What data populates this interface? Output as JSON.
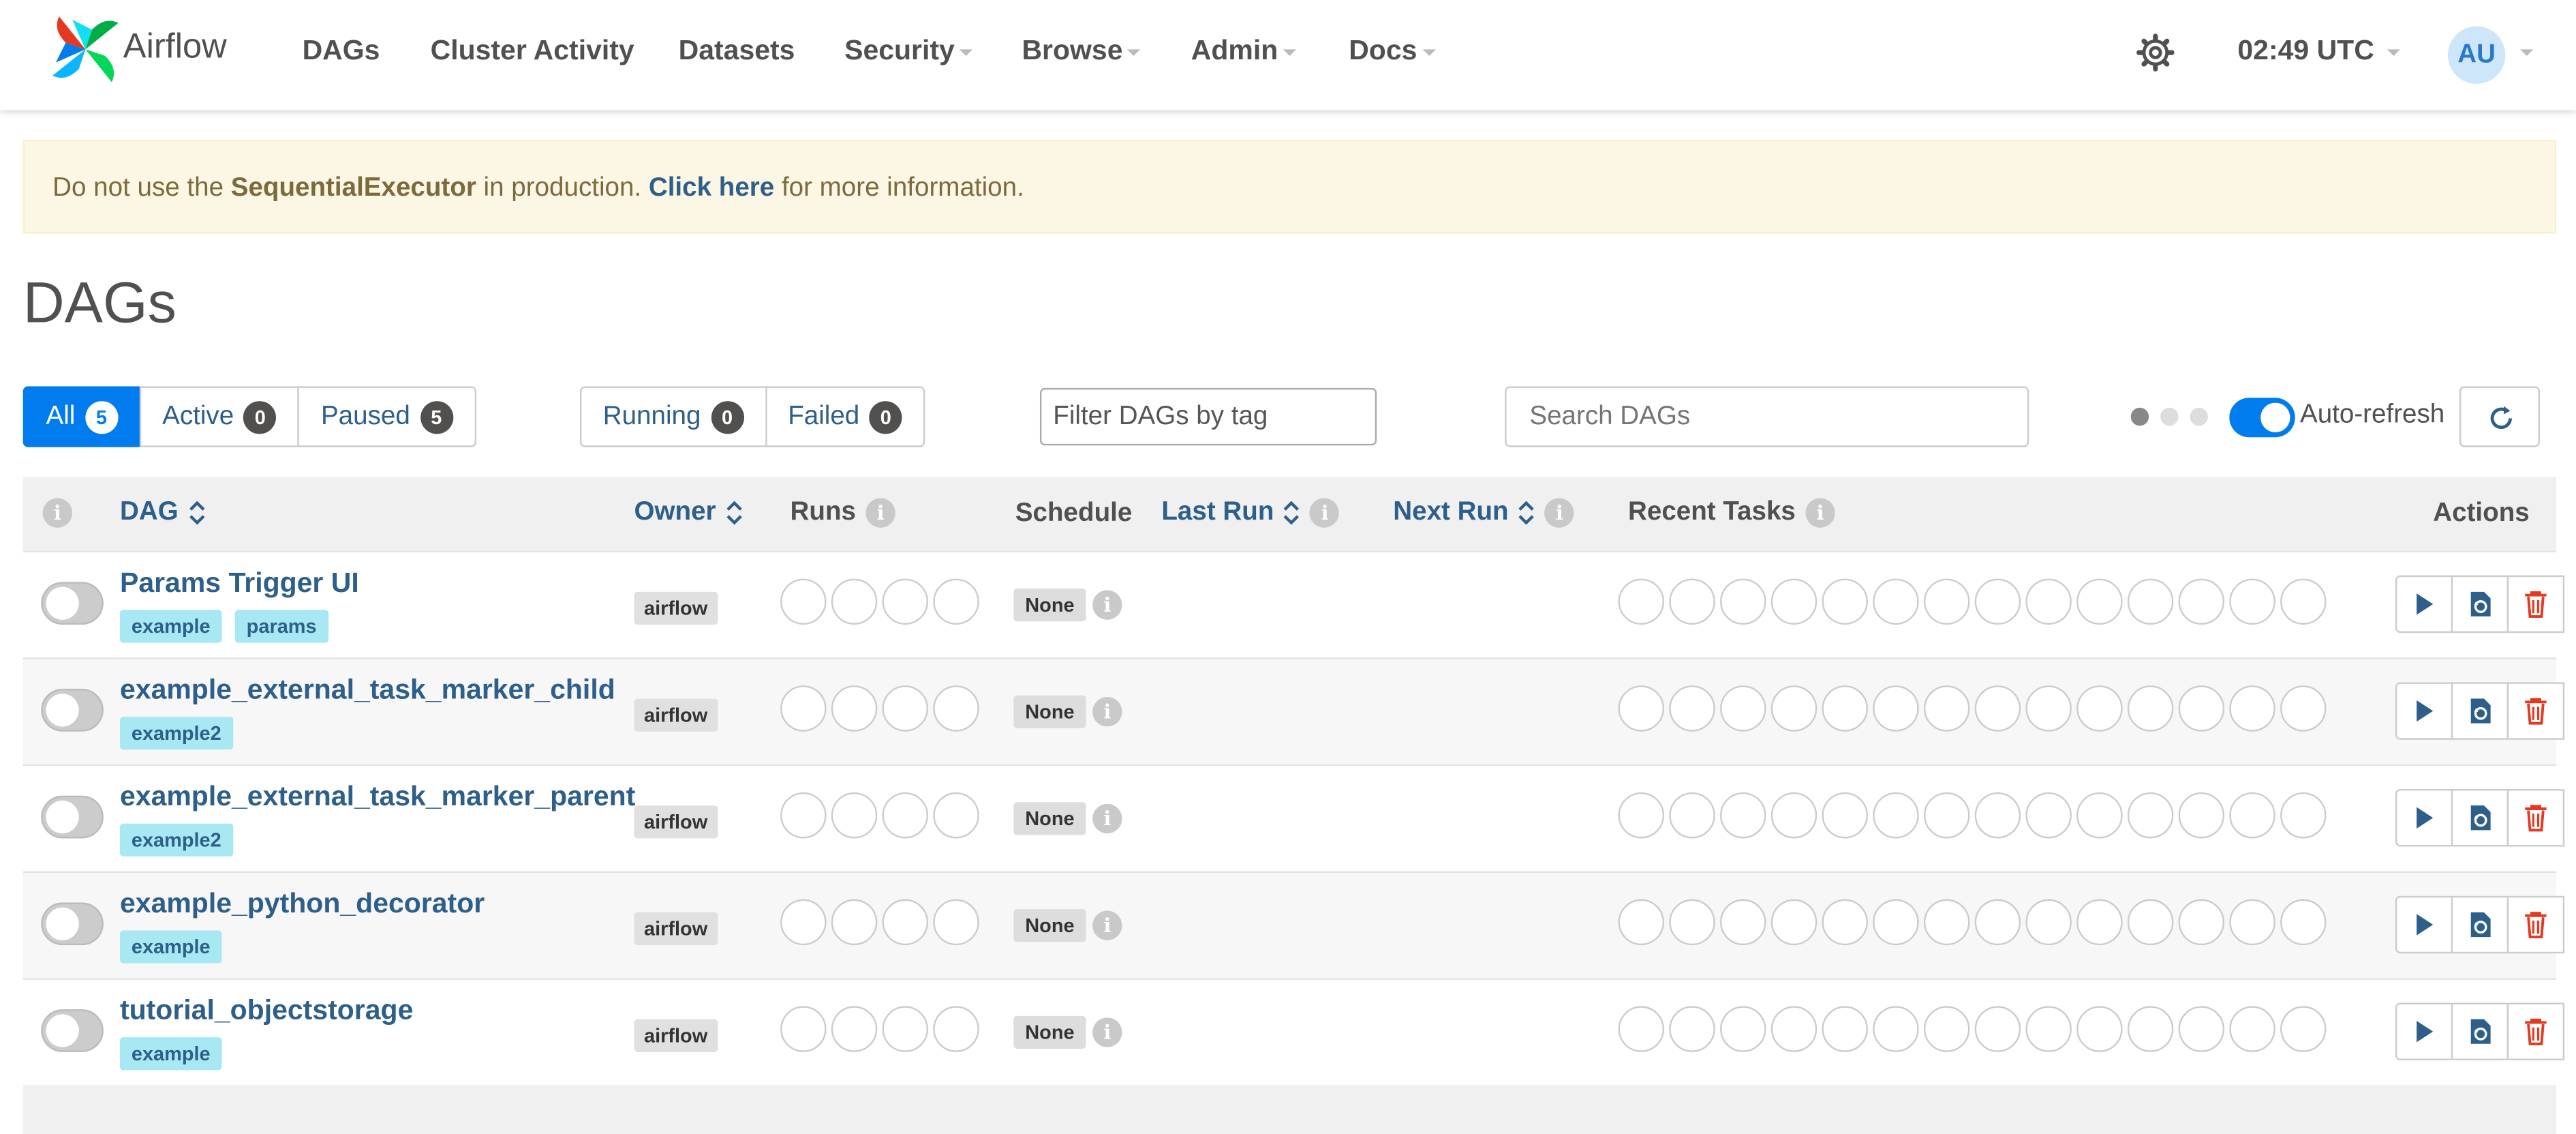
{
  "navbar": {
    "brand": "Airflow",
    "items": [
      {
        "label": "DAGs",
        "dropdown": false
      },
      {
        "label": "Cluster Activity",
        "dropdown": false
      },
      {
        "label": "Datasets",
        "dropdown": false
      },
      {
        "label": "Security",
        "dropdown": true
      },
      {
        "label": "Browse",
        "dropdown": true
      },
      {
        "label": "Admin",
        "dropdown": true
      },
      {
        "label": "Docs",
        "dropdown": true
      }
    ],
    "time": "02:49 UTC",
    "user_initials": "AU"
  },
  "alert": {
    "prefix": "Do not use the ",
    "executor": "SequentialExecutor",
    "middle": " in production. ",
    "link": "Click here",
    "suffix": " for more information."
  },
  "page_title": "DAGs",
  "status_filters": [
    {
      "label": "All",
      "count": "5",
      "active": true
    },
    {
      "label": "Active",
      "count": "0",
      "active": false
    },
    {
      "label": "Paused",
      "count": "5",
      "active": false
    }
  ],
  "run_filters": [
    {
      "label": "Running",
      "count": "0"
    },
    {
      "label": "Failed",
      "count": "0"
    }
  ],
  "tag_filter_placeholder": "Filter DAGs by tag",
  "search_placeholder": "Search DAGs",
  "auto_refresh_label": "Auto-refresh",
  "columns": {
    "dag": "DAG",
    "owner": "Owner",
    "runs": "Runs",
    "schedule": "Schedule",
    "last_run": "Last Run",
    "next_run": "Next Run",
    "recent_tasks": "Recent Tasks",
    "actions": "Actions"
  },
  "dags": [
    {
      "name": "Params Trigger UI",
      "tags": [
        "example",
        "params"
      ],
      "owner": "airflow",
      "schedule": "None"
    },
    {
      "name": "example_external_task_marker_child",
      "tags": [
        "example2"
      ],
      "owner": "airflow",
      "schedule": "None"
    },
    {
      "name": "example_external_task_marker_parent",
      "tags": [
        "example2"
      ],
      "owner": "airflow",
      "schedule": "None"
    },
    {
      "name": "example_python_decorator",
      "tags": [
        "example"
      ],
      "owner": "airflow",
      "schedule": "None"
    },
    {
      "name": "tutorial_objectstorage",
      "tags": [
        "example"
      ],
      "owner": "airflow",
      "schedule": "None"
    }
  ],
  "colors": {
    "accent": "#017cee",
    "link": "#2d5f8a",
    "tag_bg": "#a8e8f3",
    "delete": "#e43921"
  }
}
